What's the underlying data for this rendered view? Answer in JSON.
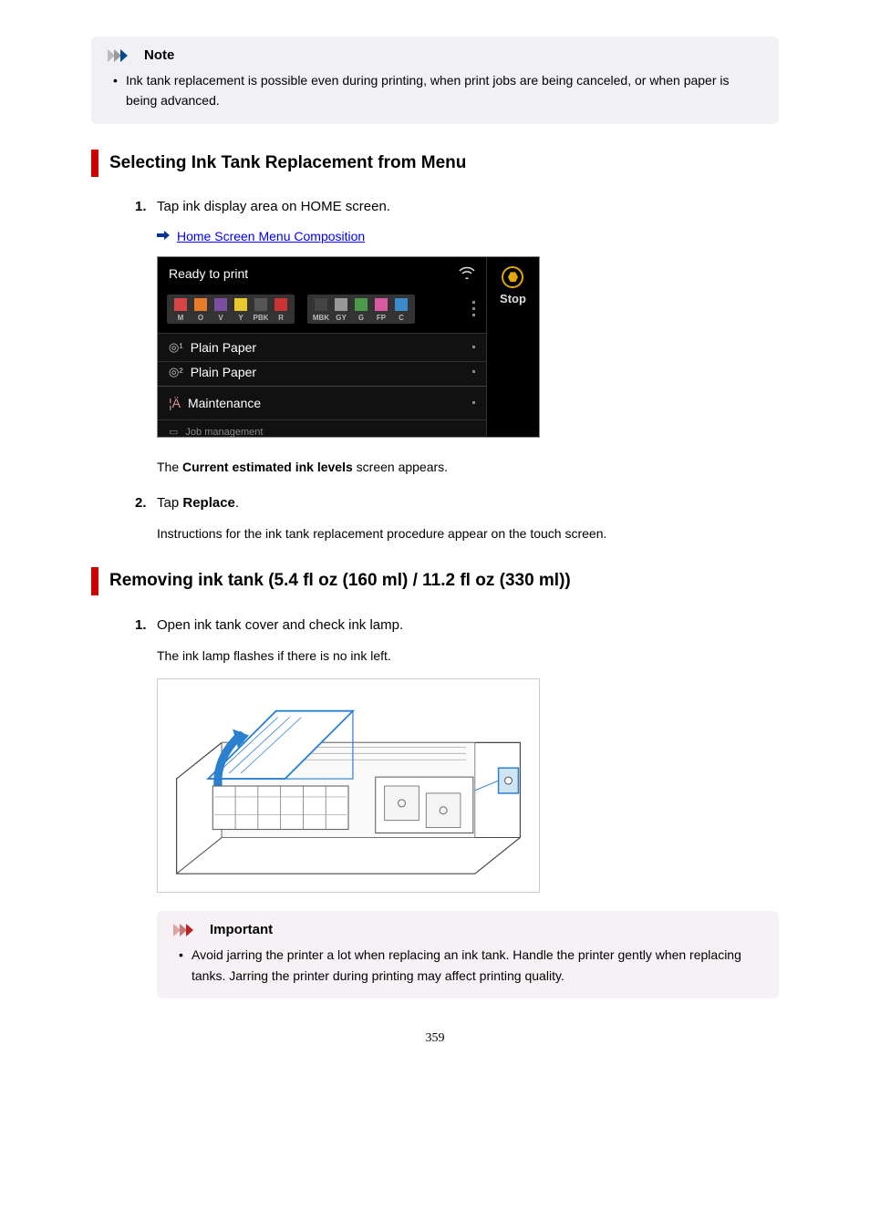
{
  "note": {
    "title": "Note",
    "text": "Ink tank replacement is possible even during printing, when print jobs are being canceled, or when paper is being advanced."
  },
  "section1": {
    "title": "Selecting Ink Tank Replacement from Menu",
    "step1": {
      "num": "1.",
      "text": "Tap ink display area on HOME screen.",
      "link": "Home Screen Menu Composition",
      "after": "The Current estimated ink levels screen appears.",
      "bold_in_after": "Current estimated ink levels"
    },
    "step2": {
      "num": "2.",
      "text_prefix": "Tap ",
      "text_bold": "Replace",
      "text_suffix": ".",
      "body": "Instructions for the ink tank replacement procedure appear on the touch screen."
    }
  },
  "screen": {
    "status": "Ready to print",
    "inks_left": [
      {
        "label": "M",
        "color": "#d94545"
      },
      {
        "label": "O",
        "color": "#e87b2a"
      },
      {
        "label": "V",
        "color": "#7a4fa0"
      },
      {
        "label": "Y",
        "color": "#e8c82a"
      },
      {
        "label": "PBK",
        "color": "#555"
      },
      {
        "label": "R",
        "color": "#cc3333"
      }
    ],
    "inks_right": [
      {
        "label": "MBK",
        "color": "#444"
      },
      {
        "label": "GY",
        "color": "#999"
      },
      {
        "label": "G",
        "color": "#4a9a4a"
      },
      {
        "label": "FP",
        "color": "#d95aa0"
      },
      {
        "label": "C",
        "color": "#3a8acc"
      }
    ],
    "paper1_icon": "①",
    "paper1": "Plain Paper",
    "paper2_icon": "②",
    "paper2": "Plain Paper",
    "maintenance": "Maintenance",
    "job": "Job management",
    "stop": "Stop"
  },
  "section2": {
    "title": "Removing ink tank (5.4 fl oz (160 ml) / 11.2 fl oz (330 ml))",
    "step1": {
      "num": "1.",
      "text": "Open ink tank cover and check ink lamp.",
      "body": "The ink lamp flashes if there is no ink left."
    }
  },
  "important": {
    "title": "Important",
    "text": "Avoid jarring the printer a lot when replacing an ink tank. Handle the printer gently when replacing tanks. Jarring the printer during printing may affect printing quality."
  },
  "page_number": "359"
}
